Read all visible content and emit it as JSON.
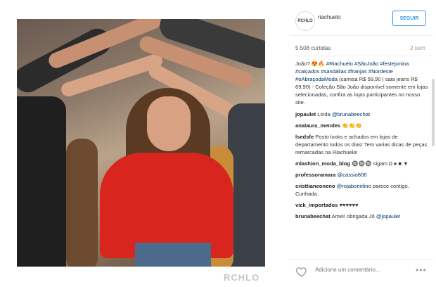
{
  "post": {
    "username": "riachuelo",
    "avatar_text": "RCHLO",
    "follow_label": "SEGUIR",
    "likes": "5.508 curtidas",
    "time": "2 sem",
    "watermark": "RCHLO"
  },
  "caption": {
    "text_before": "João? ",
    "emoji": "😍🔥",
    "tags": "#Riachuelo #SãoJoão #festejunina #calçados #sandálias #franjas #Nordeste #oAbraçodaModa",
    "body": " (camisa R$ 59,90 | saia jeans R$ 69,90) - Coleção São João disponível somente em lojas selecionadas, confira as lojas participantes no nosso site."
  },
  "comments": [
    {
      "user": "jopaulet",
      "text": " Linda ",
      "mention": "@brunabeechat"
    },
    {
      "user": "analaura_mendes",
      "text": " 👏👏👏"
    },
    {
      "user": "lsedsfe",
      "text": " Posto looks e achados em lojas de departamento todos os dias! Tem varias dicas de peças remarcadas na Riachuelo!"
    },
    {
      "user": "mlashion_moda_blog",
      "text": " 🔘🔘🔘 sigam ◘ ● ■ ▼"
    },
    {
      "user": "professoramara",
      "text": " ",
      "mention": "@cassio806"
    },
    {
      "user": "cristtianeoneno",
      "text": " ",
      "mention": "@rojabonelino",
      "tail": " parece contigo. Cunhada."
    },
    {
      "user": "vick_importados",
      "text": " ♥♥♥♥♥♥"
    },
    {
      "user": "brunabeechat",
      "text": " Amei! obrigada Jô ",
      "mention": "@jopaulet"
    }
  ],
  "input": {
    "placeholder": "Adicione um comentário..."
  },
  "icons": {
    "like": "heart-icon",
    "options": "more-options-icon"
  },
  "colors": {
    "accent": "#3897f0",
    "tag": "#003569"
  }
}
